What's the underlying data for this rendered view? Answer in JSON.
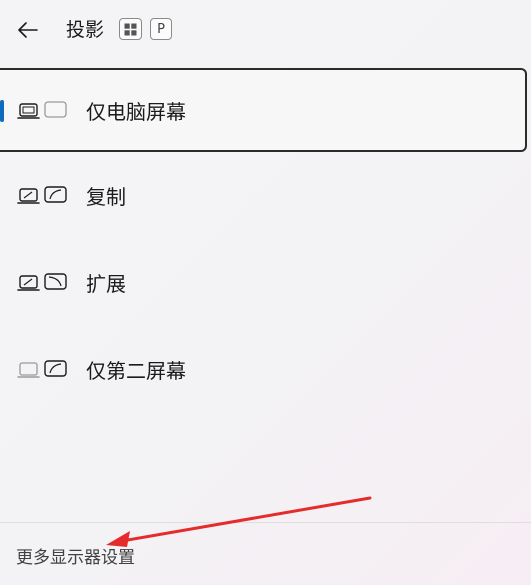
{
  "header": {
    "title": "投影",
    "shortcut_keys": [
      "⊞",
      "P"
    ]
  },
  "options": [
    {
      "label": "仅电脑屏幕",
      "icon": "pc-screen-only-icon",
      "selected": true
    },
    {
      "label": "复制",
      "icon": "duplicate-icon",
      "selected": false
    },
    {
      "label": "扩展",
      "icon": "extend-icon",
      "selected": false
    },
    {
      "label": "仅第二屏幕",
      "icon": "second-screen-only-icon",
      "selected": false
    }
  ],
  "footer": {
    "link_label": "更多显示器设置"
  },
  "colors": {
    "accent": "#0f6cbd",
    "annotation_arrow": "#e52b2b"
  }
}
